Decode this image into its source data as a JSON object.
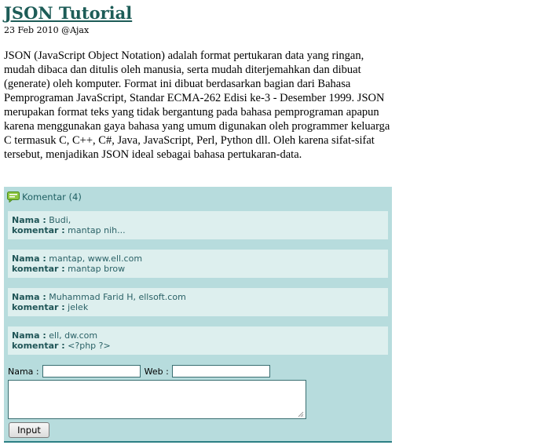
{
  "article": {
    "title": "JSON Tutorial",
    "meta": "23 Feb 2010 @Ajax",
    "body": "JSON (JavaScript Object Notation) adalah format pertukaran data yang ringan, mudah dibaca dan ditulis oleh manusia, serta mudah diterjemahkan dan dibuat (generate) oleh komputer. Format ini dibuat berdasarkan bagian dari Bahasa Pemprograman JavaScript, Standar ECMA-262 Edisi ke-3 - Desember 1999. JSON merupakan format teks yang tidak bergantung pada bahasa pemprograman apapun karena menggunakan gaya bahasa yang umum digunakan oleh programmer keluarga C termasuk C, C++, C#, Java, JavaScript, Perl, Python dll. Oleh karena sifat-sifat tersebut, menjadikan JSON ideal sebagai bahasa pertukaran-data."
  },
  "comments": {
    "header": "Komentar (4)",
    "icon": "chat-bubble-icon",
    "name_label": "Nama :",
    "comment_label": "komentar :",
    "items": [
      {
        "name": "Budi,",
        "text": "mantap nih..."
      },
      {
        "name": "mantap, www.ell.com",
        "text": "mantap brow"
      },
      {
        "name": "Muhammad Farid H, ellsoft.com",
        "text": "jelek"
      },
      {
        "name": "ell, dw.com",
        "text": "<?php ?>"
      }
    ]
  },
  "form": {
    "name_label": "Nama :",
    "web_label": "Web :",
    "name_value": "",
    "web_value": "",
    "comment_value": "",
    "submit_label": "Input"
  },
  "colors": {
    "title": "#1d5c57",
    "panel_bg": "#b7dcdd",
    "comment_bg": "#ddefee",
    "panel_border": "#2c7f84"
  }
}
